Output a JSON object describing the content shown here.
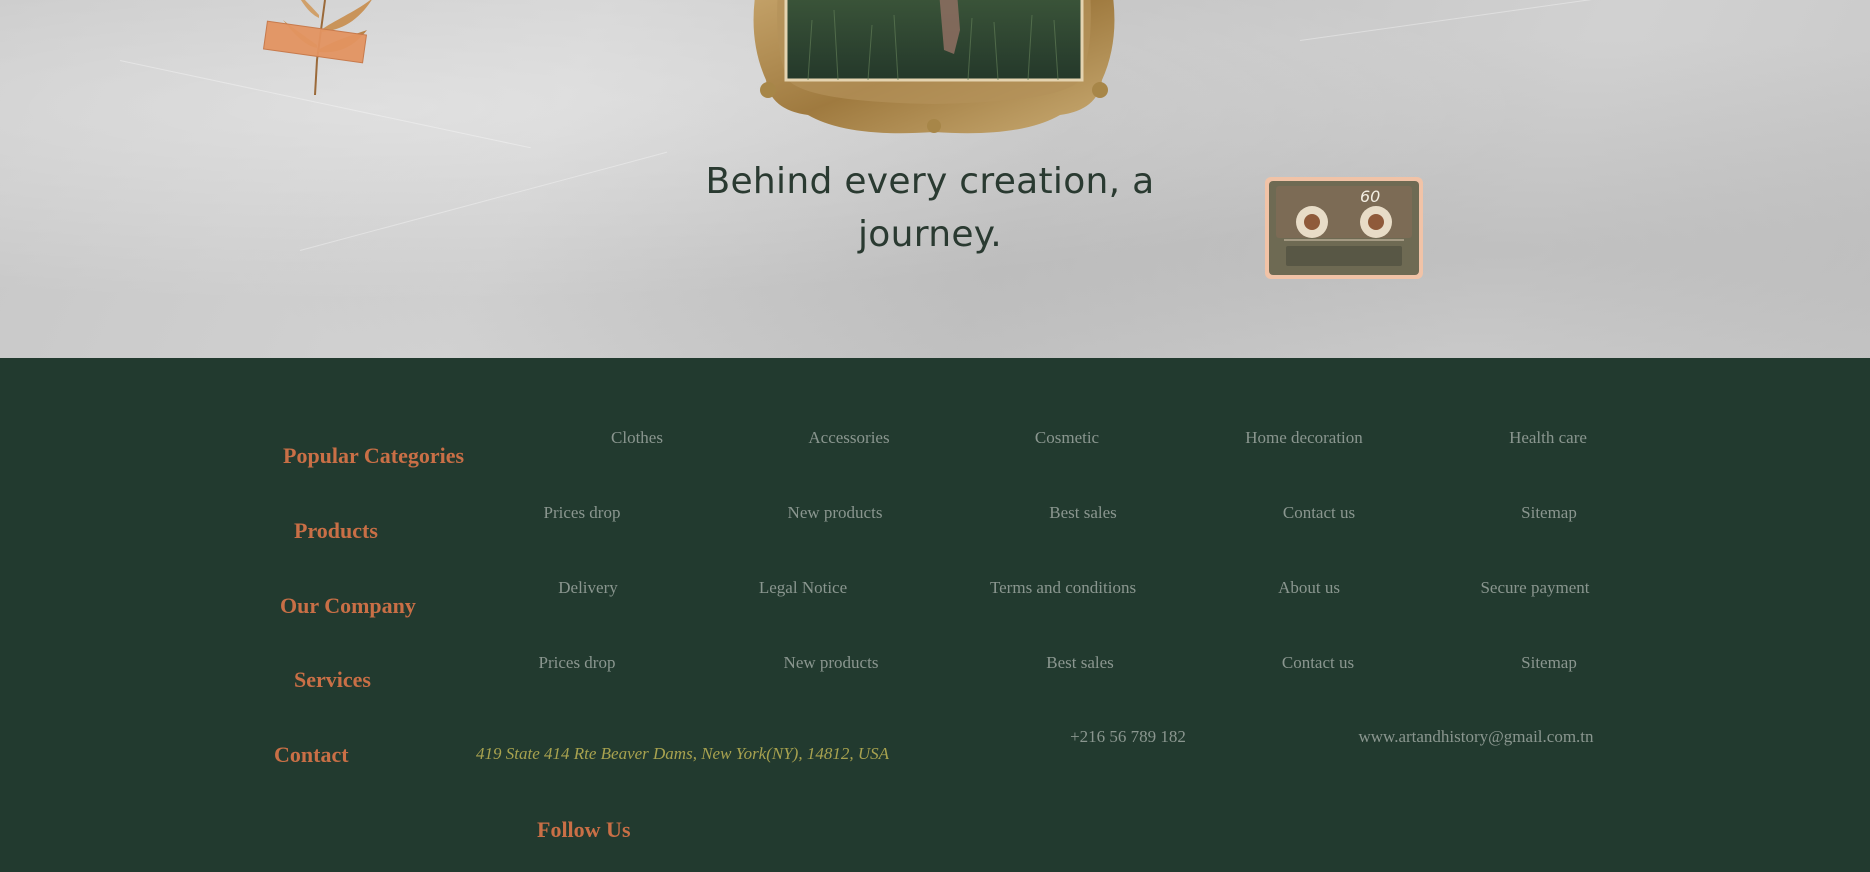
{
  "hero": {
    "tagline_line1": "Behind every creation, a",
    "tagline_line2": "journey.",
    "cassette_label": "60"
  },
  "footer": {
    "headings": {
      "popular_categories": "Popular Categories",
      "products": "Products",
      "our_company": "Our Company",
      "services": "Services",
      "contact": "Contact",
      "follow_us": "Follow Us"
    },
    "popular_categories": [
      "Clothes",
      "Accessories",
      "Cosmetic",
      "Home decoration",
      "Health care"
    ],
    "products": [
      "Prices drop",
      "New products",
      "Best sales",
      "Contact us",
      "Sitemap"
    ],
    "our_company": [
      "Delivery",
      "Legal Notice",
      "Terms and conditions",
      "About us",
      "Secure payment"
    ],
    "services": [
      "Prices drop",
      "New products",
      "Best sales",
      "Contact us",
      "Sitemap"
    ],
    "contact": {
      "address": "419 State 414 Rte Beaver Dams, New York(NY), 14812, USA",
      "phone": "+216 56 789 182",
      "email": "www.artandhistory@gmail.com.tn"
    }
  },
  "colors": {
    "footer_bg": "#223a2f",
    "heading": "#c96f46",
    "link": "#8a968f",
    "address": "#a8a24f",
    "paper": "#cfcfcf"
  }
}
